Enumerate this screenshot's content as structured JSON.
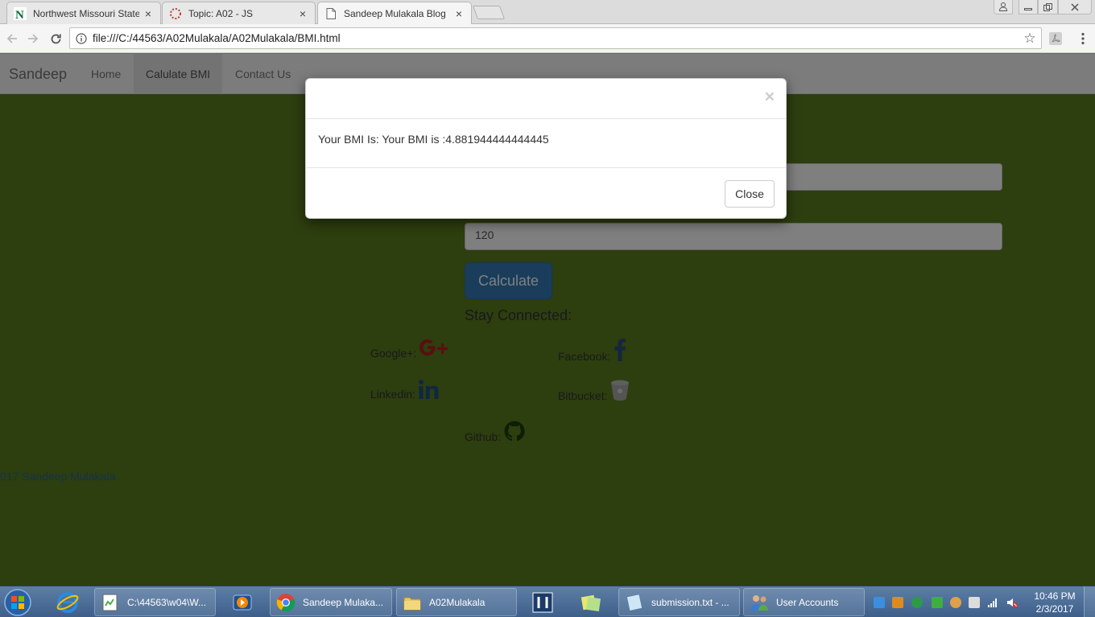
{
  "browser": {
    "tabs": [
      {
        "title": "Northwest Missouri State",
        "icon": "northwest-n-icon"
      },
      {
        "title": "Topic: A02 - JS",
        "icon": "loading-spinner-icon"
      },
      {
        "title": "Sandeep Mulakala Blog",
        "icon": "page-icon"
      }
    ],
    "url": "file:///C:/44563/A02Mulakala/A02Mulakala/BMI.html"
  },
  "site": {
    "brand": "Sandeep",
    "nav": [
      "Home",
      "Calulate BMI",
      "Contact Us"
    ],
    "height_value": "120",
    "calculate_label": "Calculate",
    "stay_connected": "Stay Connected:",
    "social": {
      "google": "Google+:",
      "facebook": "Facebook:",
      "linkedin": "Linkedin:",
      "bitbucket": "Bitbucket:",
      "github": "Github:"
    },
    "footer": "017 Sandeep Mulakala"
  },
  "modal": {
    "close_x": "×",
    "message": "Your BMI Is: Your BMI is :4.881944444444445",
    "close_label": "Close"
  },
  "taskbar": {
    "items": [
      {
        "label": "C:\\44563\\w04\\W...",
        "icon": "notepad-plus-icon"
      },
      {
        "label": "Sandeep Mulaka...",
        "icon": "chrome-icon"
      },
      {
        "label": "A02Mulakala",
        "icon": "folder-icon"
      },
      {
        "label": "submission.txt - ...",
        "icon": "notepad-icon"
      },
      {
        "label": "User Accounts",
        "icon": "users-icon"
      }
    ],
    "time": "10:46 PM",
    "date": "2/3/2017"
  },
  "colors": {
    "page_background": "#5b7d1f",
    "primary_button": "#337ab7",
    "google_red": "#dd4b39",
    "facebook_blue": "#3b5998",
    "linkedin_blue": "#0e76a8"
  }
}
